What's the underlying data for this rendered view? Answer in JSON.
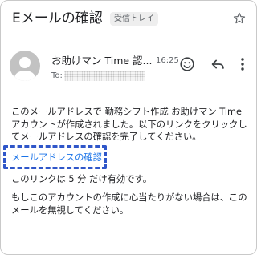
{
  "email": {
    "subject": "Eメールの確認",
    "label_badge": "受信トレイ",
    "sender": "お助けマン Time 認...",
    "time": "16:25",
    "to_label": "To:",
    "body_paragraph_1": "このメールアドレスで 勤務シフト作成 お助けマン Time アカウントが作成されました。以下のリンクをクリックしてメールアドレスの確認を完了してください。",
    "confirm_link": "メールアドレスの確認",
    "body_paragraph_2": "このリンクは 5 分 だけ有効です。",
    "body_paragraph_3": "もしこのアカウントの作成に心当たりがない場合は、このメールを無視してください。"
  },
  "icons": {
    "star": "star-outline-icon",
    "avatar": "person-avatar-icon",
    "emoji": "smiley-face-icon",
    "reply": "reply-arrow-icon",
    "more": "more-vertical-icon"
  },
  "colors": {
    "link": "#1a73e8",
    "highlight_box": "#2f56c9",
    "avatar_bg": "#c2c2c2",
    "badge_bg": "#eeeeee"
  }
}
